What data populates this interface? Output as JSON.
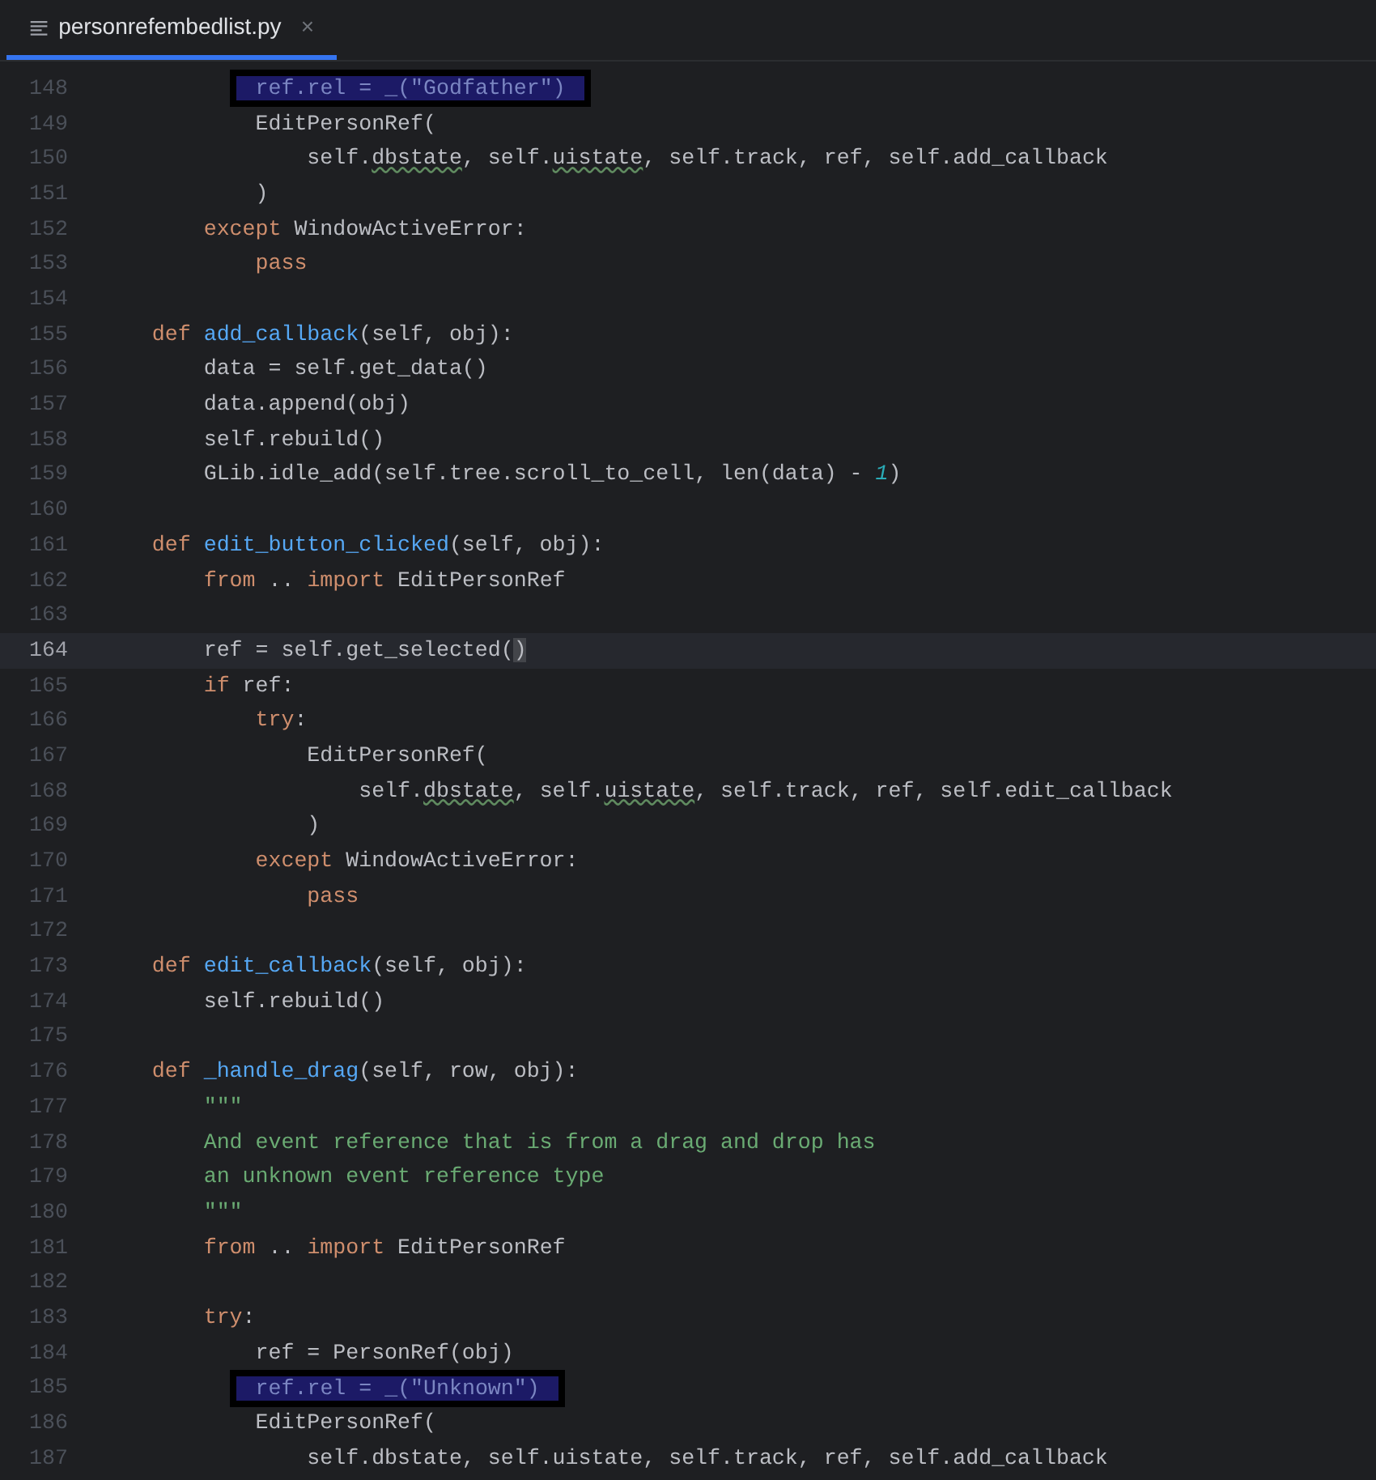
{
  "tab": {
    "label": "personrefembedlist.py",
    "close": "×",
    "selected": true
  },
  "lines": [
    {
      "number": "148",
      "current": false,
      "boxed": true,
      "tokens": [
        {
          "text": "            ref.rel = _(\"Godfather\")",
          "kind": "plain"
        }
      ]
    },
    {
      "number": "149",
      "current": false,
      "boxed": false,
      "tokens": [
        {
          "text": "            EditPersonRef(",
          "kind": "plain"
        }
      ]
    },
    {
      "number": "150",
      "current": false,
      "boxed": false,
      "tokens": [
        {
          "text": "                self.",
          "kind": "plain"
        },
        {
          "text": "dbstate",
          "kind": "warn"
        },
        {
          "text": ", self.",
          "kind": "plain"
        },
        {
          "text": "uistate",
          "kind": "warn"
        },
        {
          "text": ", self.track, ref, self.add_callback",
          "kind": "plain"
        }
      ]
    },
    {
      "number": "151",
      "current": false,
      "boxed": false,
      "tokens": [
        {
          "text": "            )",
          "kind": "plain"
        }
      ]
    },
    {
      "number": "152",
      "current": false,
      "boxed": false,
      "tokens": [
        {
          "text": "        except",
          "kind": "kw"
        },
        {
          "text": " WindowActiveError:",
          "kind": "plain"
        }
      ]
    },
    {
      "number": "153",
      "current": false,
      "boxed": false,
      "tokens": [
        {
          "text": "            pass",
          "kind": "kw"
        }
      ]
    },
    {
      "number": "154",
      "current": false,
      "boxed": false
    },
    {
      "number": "155",
      "current": false,
      "boxed": false,
      "tokens": [
        {
          "text": "    def",
          "kind": "kw"
        },
        {
          "text": " add_callback",
          "kind": "fn"
        },
        {
          "text": "(self, obj):",
          "kind": "plain"
        }
      ]
    },
    {
      "number": "156",
      "current": false,
      "boxed": false,
      "tokens": [
        {
          "text": "        data = self.get_data()",
          "kind": "plain"
        }
      ]
    },
    {
      "number": "157",
      "current": false,
      "boxed": false,
      "tokens": [
        {
          "text": "        data.append(obj)",
          "kind": "plain"
        }
      ]
    },
    {
      "number": "158",
      "current": false,
      "boxed": false,
      "tokens": [
        {
          "text": "        self.rebuild()",
          "kind": "plain"
        }
      ]
    },
    {
      "number": "159",
      "current": false,
      "boxed": false,
      "tokens": [
        {
          "text": "        GLib.idle_add(self.tree.scroll_to_cell, len(data) - ",
          "kind": "plain"
        },
        {
          "text": "1",
          "kind": "num"
        },
        {
          "text": ")",
          "kind": "plain"
        }
      ]
    },
    {
      "number": "160",
      "current": false,
      "boxed": false
    },
    {
      "number": "161",
      "current": false,
      "boxed": false,
      "tokens": [
        {
          "text": "    def",
          "kind": "kw"
        },
        {
          "text": " edit_button_clicked",
          "kind": "fn"
        },
        {
          "text": "(self, obj):",
          "kind": "plain"
        }
      ]
    },
    {
      "number": "162",
      "current": false,
      "boxed": false,
      "tokens": [
        {
          "text": "        from",
          "kind": "kw"
        },
        {
          "text": " .. ",
          "kind": "plain"
        },
        {
          "text": "import",
          "kind": "kw"
        },
        {
          "text": " EditPersonRef",
          "kind": "plain"
        }
      ]
    },
    {
      "number": "163",
      "current": false,
      "boxed": false
    },
    {
      "number": "164",
      "current": true,
      "boxed": false,
      "tokens": [
        {
          "text": "        ref = self.get_selected(",
          "kind": "plain"
        },
        {
          "text": ")",
          "kind": "match"
        }
      ]
    },
    {
      "number": "165",
      "current": false,
      "boxed": false,
      "tokens": [
        {
          "text": "        if",
          "kind": "kw"
        },
        {
          "text": " ref:",
          "kind": "plain"
        }
      ]
    },
    {
      "number": "166",
      "current": false,
      "boxed": false,
      "tokens": [
        {
          "text": "            try",
          "kind": "kw"
        },
        {
          "text": ":",
          "kind": "plain"
        }
      ]
    },
    {
      "number": "167",
      "current": false,
      "boxed": false,
      "tokens": [
        {
          "text": "                EditPersonRef(",
          "kind": "plain"
        }
      ]
    },
    {
      "number": "168",
      "current": false,
      "boxed": false,
      "tokens": [
        {
          "text": "                    self.",
          "kind": "plain"
        },
        {
          "text": "dbstate",
          "kind": "warn"
        },
        {
          "text": ", self.",
          "kind": "plain"
        },
        {
          "text": "uistate",
          "kind": "warn"
        },
        {
          "text": ", self.track, ref, self.edit_callback",
          "kind": "plain"
        }
      ]
    },
    {
      "number": "169",
      "current": false,
      "boxed": false,
      "tokens": [
        {
          "text": "                )",
          "kind": "plain"
        }
      ]
    },
    {
      "number": "170",
      "current": false,
      "boxed": false,
      "tokens": [
        {
          "text": "            except",
          "kind": "kw"
        },
        {
          "text": " WindowActiveError:",
          "kind": "plain"
        }
      ]
    },
    {
      "number": "171",
      "current": false,
      "boxed": false,
      "tokens": [
        {
          "text": "                pass",
          "kind": "kw"
        }
      ]
    },
    {
      "number": "172",
      "current": false,
      "boxed": false
    },
    {
      "number": "173",
      "current": false,
      "boxed": false,
      "tokens": [
        {
          "text": "    def",
          "kind": "kw"
        },
        {
          "text": " edit_callback",
          "kind": "fn"
        },
        {
          "text": "(self, obj):",
          "kind": "plain"
        }
      ]
    },
    {
      "number": "174",
      "current": false,
      "boxed": false,
      "tokens": [
        {
          "text": "        self.rebuild()",
          "kind": "plain"
        }
      ]
    },
    {
      "number": "175",
      "current": false,
      "boxed": false
    },
    {
      "number": "176",
      "current": false,
      "boxed": false,
      "tokens": [
        {
          "text": "    def",
          "kind": "kw"
        },
        {
          "text": " _handle_drag",
          "kind": "fn"
        },
        {
          "text": "(self, row, obj):",
          "kind": "plain"
        }
      ]
    },
    {
      "number": "177",
      "current": false,
      "boxed": false,
      "tokens": [
        {
          "text": "        \"\"\"",
          "kind": "doc"
        }
      ]
    },
    {
      "number": "178",
      "current": false,
      "boxed": false,
      "tokens": [
        {
          "text": "        And event reference that is from a drag and drop has",
          "kind": "doc"
        }
      ]
    },
    {
      "number": "179",
      "current": false,
      "boxed": false,
      "tokens": [
        {
          "text": "        an unknown event reference type",
          "kind": "doc"
        }
      ]
    },
    {
      "number": "180",
      "current": false,
      "boxed": false,
      "tokens": [
        {
          "text": "        \"\"\"",
          "kind": "doc"
        }
      ]
    },
    {
      "number": "181",
      "current": false,
      "boxed": false,
      "tokens": [
        {
          "text": "        from",
          "kind": "kw"
        },
        {
          "text": " .. ",
          "kind": "plain"
        },
        {
          "text": "import",
          "kind": "kw"
        },
        {
          "text": " EditPersonRef",
          "kind": "plain"
        }
      ]
    },
    {
      "number": "182",
      "current": false,
      "boxed": false
    },
    {
      "number": "183",
      "current": false,
      "boxed": false,
      "tokens": [
        {
          "text": "        try",
          "kind": "kw"
        },
        {
          "text": ":",
          "kind": "plain"
        }
      ]
    },
    {
      "number": "184",
      "current": false,
      "boxed": false,
      "tokens": [
        {
          "text": "            ref = PersonRef(obj)",
          "kind": "plain"
        }
      ]
    },
    {
      "number": "185",
      "current": false,
      "boxed": true,
      "tokens": [
        {
          "text": "            ref.rel = _(\"Unknown\")",
          "kind": "plain"
        }
      ]
    },
    {
      "number": "186",
      "current": false,
      "boxed": false,
      "tokens": [
        {
          "text": "            EditPersonRef(",
          "kind": "plain"
        }
      ]
    },
    {
      "number": "187",
      "current": false,
      "boxed": false,
      "tokens": [
        {
          "text": "                self.dbstate, self.uistate, self.track, ref, self.add_callback",
          "kind": "plain"
        }
      ]
    }
  ]
}
